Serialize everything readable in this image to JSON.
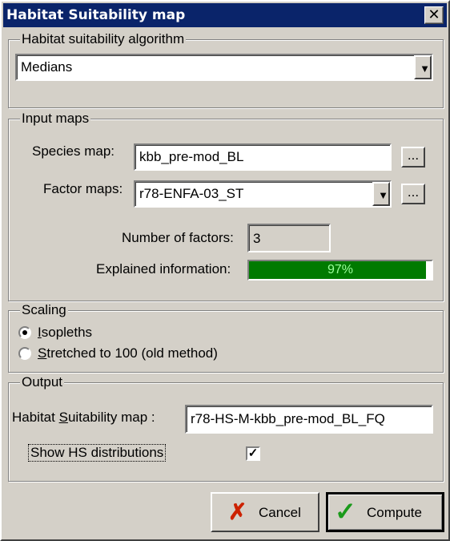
{
  "window": {
    "title": "Habitat Suitability map",
    "close_glyph": "✕"
  },
  "algorithm": {
    "legend": "Habitat suitability algorithm",
    "selected": "Medians"
  },
  "input_maps": {
    "legend": "Input maps",
    "species_label": "Species map:",
    "species_value": "kbb_pre-mod_BL",
    "factor_label": "Factor maps:",
    "factor_value": "r78-ENFA-03_ST",
    "browse_label": "...",
    "num_factors_label": "Number of factors:",
    "num_factors_value": "3",
    "explained_label": "Explained information:",
    "explained_value": "97%",
    "explained_fraction": 0.97
  },
  "scaling": {
    "legend": "Scaling",
    "isopleths_label": "Isopleths",
    "stretched_label": "Stretched to 100 (old method)",
    "selected": "isopleths"
  },
  "output": {
    "legend": "Output",
    "hs_map_label": "Habitat Suitability map :",
    "hs_map_value": "r78-HS-M-kbb_pre-mod_BL_FQ",
    "show_hs_label": "Show HS distributions",
    "show_hs_checked": true
  },
  "buttons": {
    "cancel": "Cancel",
    "compute": "Compute"
  },
  "colors": {
    "titlebar": "#0a246a",
    "progress": "#007a00",
    "cancel_icon": "#cc2200",
    "compute_icon": "#1a9a1a"
  }
}
